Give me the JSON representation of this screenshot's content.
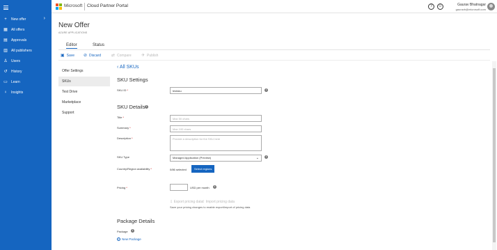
{
  "sidebar": {
    "items": [
      {
        "icon": "plus-icon",
        "glyph": "+",
        "label": "New offer"
      },
      {
        "icon": "grid-icon",
        "glyph": "▦",
        "label": "All offers"
      },
      {
        "icon": "approvals-icon",
        "glyph": "▤",
        "label": "Approvals"
      },
      {
        "icon": "publishers-icon",
        "glyph": "▥",
        "label": "All publishers"
      },
      {
        "icon": "user-icon",
        "glyph": "♙",
        "label": "Users"
      },
      {
        "icon": "history-icon",
        "glyph": "↺",
        "label": "History"
      },
      {
        "icon": "book-icon",
        "glyph": "▭",
        "label": "Learn"
      },
      {
        "icon": "lightbulb-icon",
        "glyph": "♀",
        "label": "Insights"
      }
    ],
    "new_offer_chevron": "›"
  },
  "header": {
    "brand": "Microsoft",
    "portal_title": "Cloud Partner Portal",
    "help_glyph": "?",
    "feedback_glyph": "☺",
    "user_name": "Gaurav Bhatnagar",
    "user_email": "gauravb@microsoft.com",
    "logo_colors": [
      "#f25022",
      "#7fba00",
      "#00a4ef",
      "#ffb900"
    ]
  },
  "page": {
    "title": "New Offer",
    "subtitle": "AZURE APPLICATIONS",
    "tabs": [
      {
        "label": "Editor"
      },
      {
        "label": "Status"
      }
    ]
  },
  "commands": {
    "save": "Save",
    "discard": "Discard",
    "compare": "Compare",
    "publish": "Publish"
  },
  "left_nav": {
    "items": [
      {
        "label": "Offer Settings"
      },
      {
        "label": "SKUs"
      },
      {
        "label": "Test Drive"
      },
      {
        "label": "Marketplace"
      },
      {
        "label": "Support"
      }
    ]
  },
  "content": {
    "back_link": "All SKUs",
    "sku_settings_heading": "SKU Settings",
    "sku_id_label": "SKU ID",
    "sku_id_value": "testsku",
    "sku_details_heading": "SKU Details",
    "title_label": "Title",
    "title_placeholder": "Max 50 chars",
    "summary_label": "Summary",
    "summary_placeholder": "Max 100 chars",
    "description_label": "Description",
    "description_placeholder": "Provide a description for the SKU here",
    "sku_type_label": "SKU Type",
    "sku_type_value": "Managed Application (Preview)",
    "country_label": "Country/Region availability",
    "country_selected": "0/86 selected",
    "select_regions_button": "Select regions",
    "pricing_label": "Pricing",
    "pricing_unit": "USD per month",
    "export_pricing": "Export pricing data",
    "import_pricing": "Import pricing data",
    "pricing_note": "Save your pricing changes to enable export/import of pricing data",
    "package_details_heading": "Package Details",
    "package_label": "Package",
    "new_package": "New Package",
    "required_marker": "*",
    "info_glyph": "i"
  }
}
